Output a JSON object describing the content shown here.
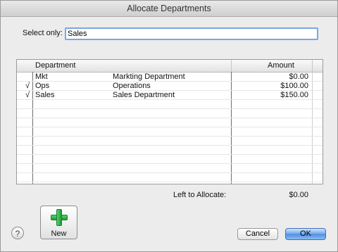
{
  "window": {
    "title": "Allocate Departments"
  },
  "filter": {
    "label": "Select only:",
    "value": "Sales"
  },
  "table": {
    "headers": {
      "department": "Department",
      "amount": "Amount"
    },
    "rows": [
      {
        "checked": "",
        "code": "Mkt",
        "description": "Markting Department",
        "amount": "$0.00"
      },
      {
        "checked": "√",
        "code": "Ops",
        "description": "Operations",
        "amount": "$100.00"
      },
      {
        "checked": "√",
        "code": "Sales",
        "description": "Sales Department",
        "amount": "$150.00"
      }
    ],
    "empty_row_count": 10
  },
  "allocation": {
    "label": "Left to Allocate:",
    "value": "$0.00"
  },
  "buttons": {
    "new": "New",
    "help": "?",
    "cancel": "Cancel",
    "ok": "OK"
  },
  "icons": {
    "new": "plus-icon",
    "help": "help-icon"
  },
  "colors": {
    "ok_button": "#6ea6ea",
    "plus_icon": "#2fb14a",
    "input_focus": "#7aa7e0"
  }
}
